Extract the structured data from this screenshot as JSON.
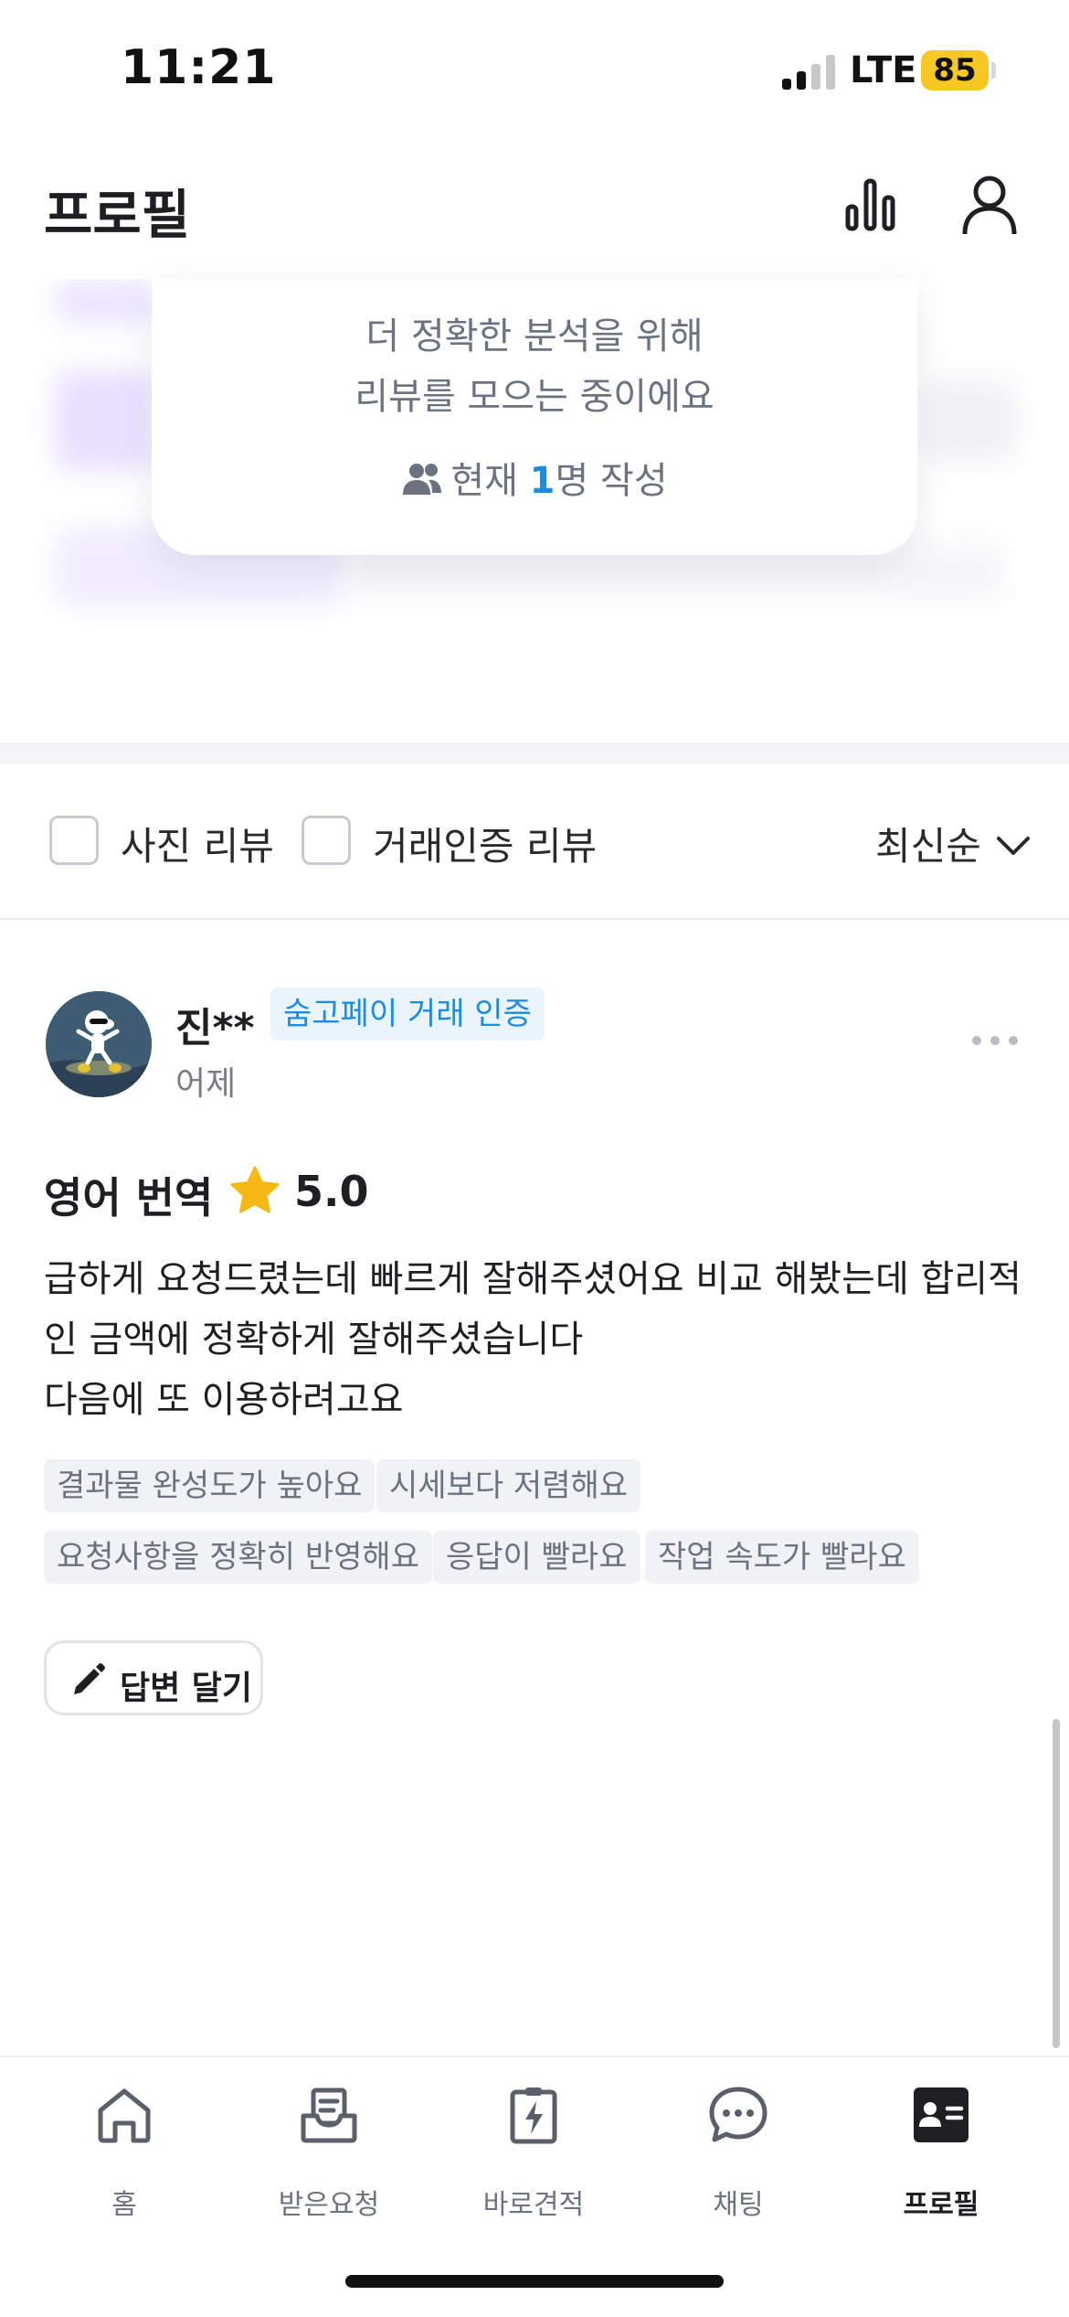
{
  "status_bar": {
    "time": "11:21",
    "network": "LTE",
    "battery": "85"
  },
  "header": {
    "title": "프로필",
    "icons": [
      "stats-icon",
      "user-icon"
    ]
  },
  "notice": {
    "line1": "더 정확한 분석을 위해",
    "line2": "리뷰를 모으는 중이에요",
    "count_prefix": "현재 ",
    "count_num": "1",
    "count_suffix": "명 작성"
  },
  "filters": {
    "photo_review": "사진 리뷰",
    "verified_review": "거래인증 리뷰",
    "sort": "최신순"
  },
  "review": {
    "name": "진**",
    "badge": "숨고페이 거래 인증",
    "date": "어제",
    "service": "영어 번역",
    "rating": "5.0",
    "text_line1": "급하게 요청드렸는데 빠르게 잘해주셨어요 비교 해봤는데 합리적",
    "text_line2": "인 금액에 정확하게 잘해주셨습니다",
    "text_line3": "다음에 또 이용하려고요",
    "tags": [
      "결과물 완성도가 높아요",
      "시세보다 저렴해요",
      "요청사항을 정확히 반영해요",
      "응답이 빨라요",
      "작업 속도가 빨라요"
    ],
    "reply_button": "답변 달기"
  },
  "bottom_nav": {
    "items": [
      {
        "label": "홈",
        "icon": "home-icon"
      },
      {
        "label": "받은요청",
        "icon": "inbox-icon"
      },
      {
        "label": "바로견적",
        "icon": "quick-quote-icon"
      },
      {
        "label": "채팅",
        "icon": "chat-icon"
      },
      {
        "label": "프로필",
        "icon": "profile-card-icon",
        "active": true
      }
    ]
  },
  "colors": {
    "accent_blue": "#1f8be0",
    "star": "#f5b915",
    "battery": "#f7c824"
  }
}
